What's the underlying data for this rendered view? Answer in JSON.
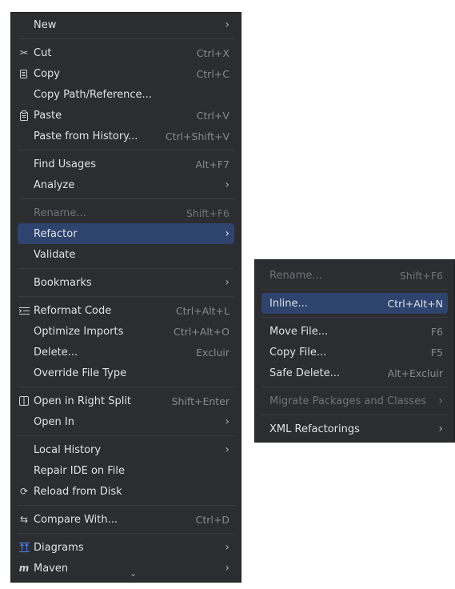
{
  "main_menu": {
    "new": {
      "label": "New"
    },
    "cut": {
      "label": "Cut",
      "shortcut": "Ctrl+X",
      "icon": "scissors-icon"
    },
    "copy": {
      "label": "Copy",
      "shortcut": "Ctrl+C",
      "icon": "copy-icon"
    },
    "copy_path": {
      "label": "Copy Path/Reference..."
    },
    "paste": {
      "label": "Paste",
      "shortcut": "Ctrl+V",
      "icon": "paste-icon"
    },
    "paste_history": {
      "label": "Paste from History...",
      "shortcut": "Ctrl+Shift+V"
    },
    "find_usages": {
      "label": "Find Usages",
      "shortcut": "Alt+F7"
    },
    "analyze": {
      "label": "Analyze"
    },
    "rename": {
      "label": "Rename...",
      "shortcut": "Shift+F6"
    },
    "refactor": {
      "label": "Refactor"
    },
    "validate": {
      "label": "Validate"
    },
    "bookmarks": {
      "label": "Bookmarks"
    },
    "reformat": {
      "label": "Reformat Code",
      "shortcut": "Ctrl+Alt+L",
      "icon": "reformat-icon"
    },
    "optimize": {
      "label": "Optimize Imports",
      "shortcut": "Ctrl+Alt+O"
    },
    "delete": {
      "label": "Delete...",
      "shortcut": "Excluir"
    },
    "override": {
      "label": "Override File Type"
    },
    "open_split": {
      "label": "Open in Right Split",
      "shortcut": "Shift+Enter",
      "icon": "split-icon"
    },
    "open_in": {
      "label": "Open In"
    },
    "local_history": {
      "label": "Local History"
    },
    "repair_ide": {
      "label": "Repair IDE on File"
    },
    "reload": {
      "label": "Reload from Disk",
      "icon": "reload-icon"
    },
    "compare": {
      "label": "Compare With...",
      "shortcut": "Ctrl+D",
      "icon": "compare-icon"
    },
    "diagrams": {
      "label": "Diagrams",
      "icon": "diagrams-icon"
    },
    "maven": {
      "label": "Maven",
      "icon": "maven-icon",
      "icon_text": "m"
    }
  },
  "sub_menu": {
    "rename": {
      "label": "Rename...",
      "shortcut": "Shift+F6"
    },
    "inline": {
      "label": "Inline...",
      "shortcut": "Ctrl+Alt+N"
    },
    "move_file": {
      "label": "Move File...",
      "shortcut": "F6"
    },
    "copy_file": {
      "label": "Copy File...",
      "shortcut": "F5"
    },
    "safe_delete": {
      "label": "Safe Delete...",
      "shortcut": "Alt+Excluir"
    },
    "migrate": {
      "label": "Migrate Packages and Classes"
    },
    "xml_refactorings": {
      "label": "XML Refactorings"
    }
  },
  "colors": {
    "menu_bg": "#2b2d30",
    "selection": "#2e436e",
    "text": "#dfe1e5",
    "disabled_text": "#6f737a",
    "shortcut_text": "#868a91"
  }
}
